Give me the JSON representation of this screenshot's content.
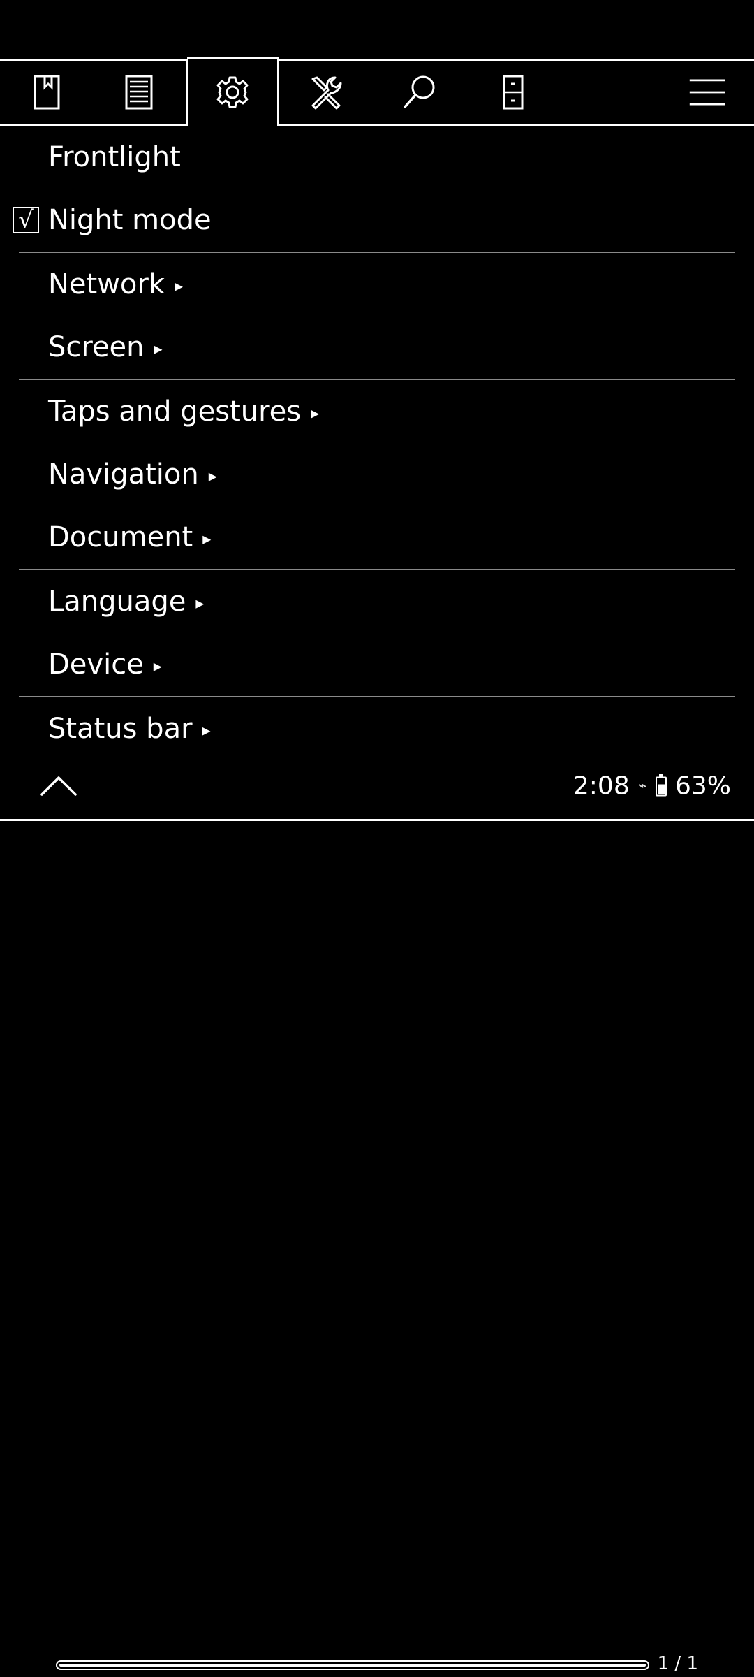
{
  "tabbar": {
    "tabs": [
      {
        "icon": "bookmark-icon"
      },
      {
        "icon": "document-lines-icon"
      },
      {
        "icon": "gear-icon",
        "active": true
      },
      {
        "icon": "tools-icon"
      },
      {
        "icon": "search-icon"
      },
      {
        "icon": "file-cabinet-icon"
      },
      {
        "icon": "menu-icon"
      }
    ]
  },
  "menu": {
    "frontlight": "Frontlight",
    "night_mode": "Night mode",
    "night_mode_checked": true,
    "check_glyph": "√",
    "network": "Network",
    "screen": "Screen",
    "taps": "Taps and gestures",
    "navigation": "Navigation",
    "document": "Document",
    "language": "Language",
    "device": "Device",
    "status_bar": "Status bar",
    "arrow": "▸"
  },
  "status": {
    "time": "2:08",
    "wifi_glyph": "⌁",
    "battery": "63%",
    "battery_level": 0.63
  },
  "footer": {
    "page": "1 / 1",
    "progress": 1.0
  }
}
